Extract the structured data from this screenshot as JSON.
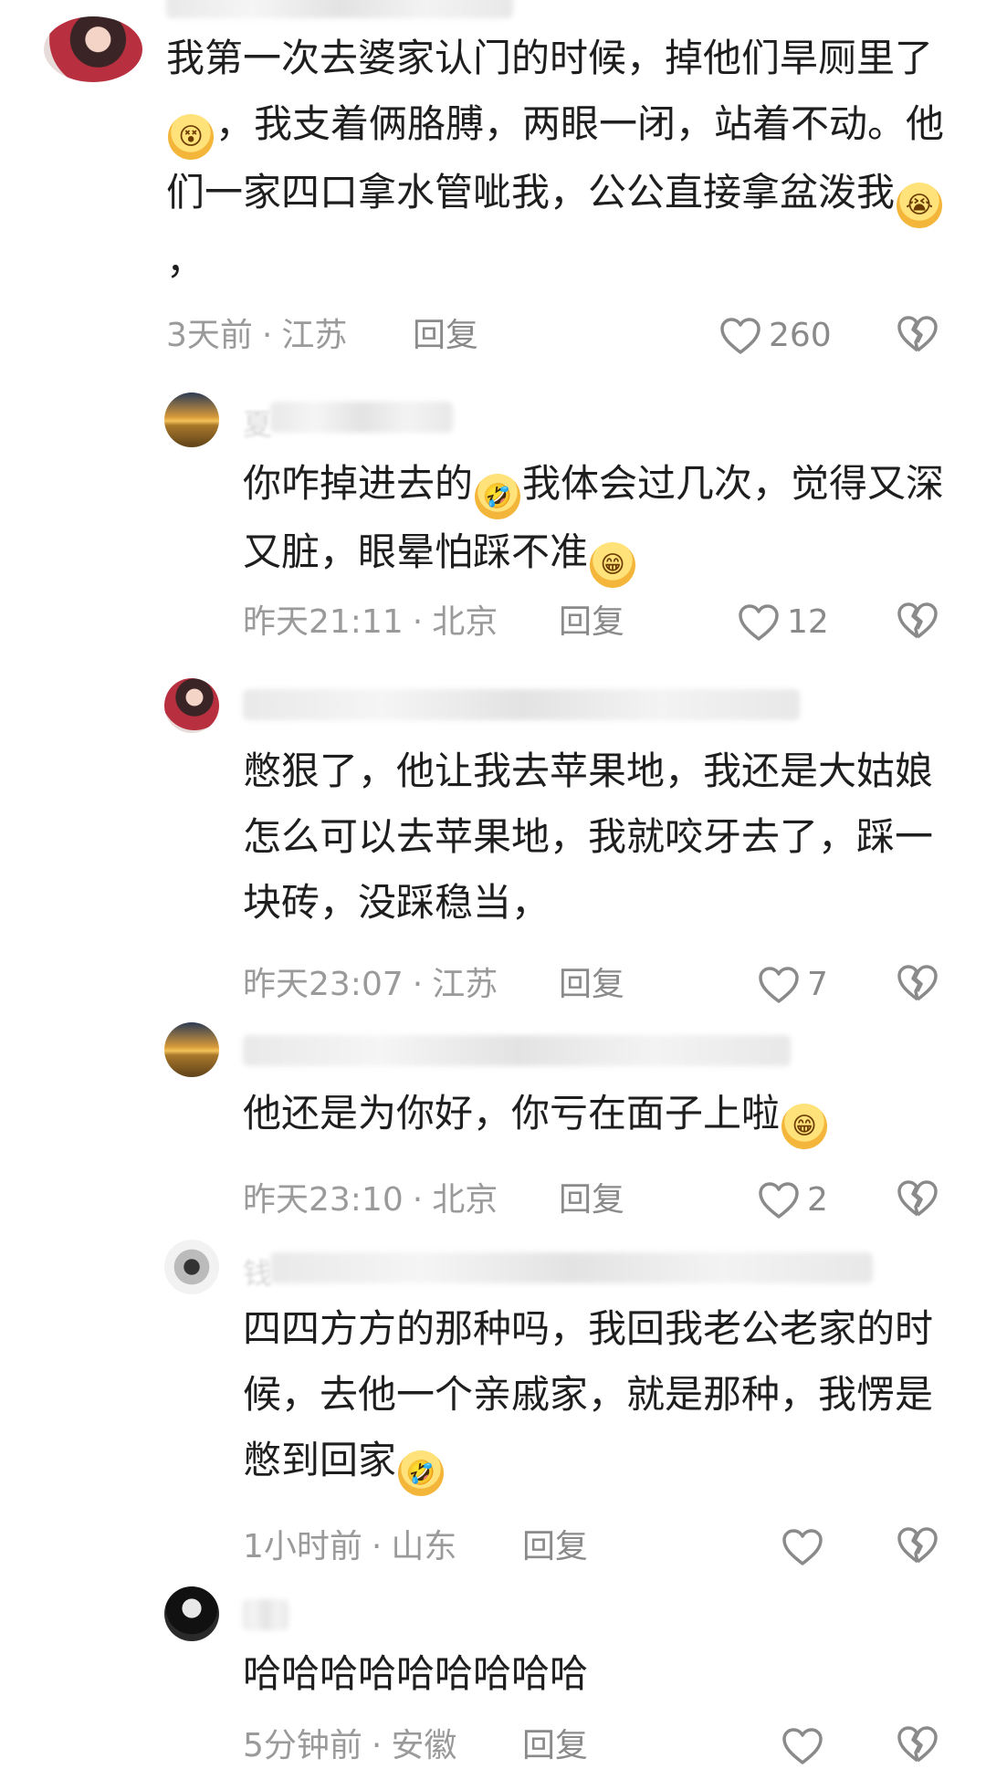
{
  "comments": [
    {
      "name_hint": "",
      "text_pre": "我第一次去婆家认门的时候，掉他们旱厕里了",
      "emoji1": "😵",
      "text_mid": "，我支着俩胳膊，两眼一闭，站着不动。他们一家四口拿水管呲我，公公直接拿盆泼我",
      "emoji2": "😭",
      "text_post": "，",
      "time": "3天前",
      "location": "江苏",
      "reply": "回复",
      "likes": "260"
    },
    {
      "name_hint": "夏",
      "text_pre": "你咋掉进去的",
      "emoji1": "🤣",
      "text_mid": "我体会过几次，觉得又深又脏，眼晕怕踩不准",
      "emoji2": "😁",
      "text_post": "",
      "time": "昨天21:11",
      "location": "北京",
      "reply": "回复",
      "likes": "12"
    },
    {
      "name_hint": "",
      "text_pre": "憋狠了，他让我去苹果地，我还是大姑娘怎么可以去苹果地，我就咬牙去了，踩一块砖，没踩稳当，",
      "emoji1": "",
      "text_mid": "",
      "emoji2": "",
      "text_post": "",
      "time": "昨天23:07",
      "location": "江苏",
      "reply": "回复",
      "likes": "7"
    },
    {
      "name_hint": "",
      "text_pre": "他还是为你好，你亏在面子上啦",
      "emoji1": "😁",
      "text_mid": "",
      "emoji2": "",
      "text_post": "",
      "time": "昨天23:10",
      "location": "北京",
      "reply": "回复",
      "likes": "2"
    },
    {
      "name_hint": "钱",
      "text_pre": "四四方方的那种吗，我回我老公老家的时候，去他一个亲戚家，就是那种，我愣是憋到回家",
      "emoji1": "🤣",
      "text_mid": "",
      "emoji2": "",
      "text_post": "",
      "time": "1小时前",
      "location": "山东",
      "reply": "回复",
      "likes": ""
    },
    {
      "name_hint": "",
      "text_pre": "哈哈哈哈哈哈哈哈哈",
      "emoji1": "",
      "text_mid": "",
      "emoji2": "",
      "text_post": "",
      "time": "5分钟前",
      "location": "安徽",
      "reply": "回复",
      "likes": ""
    }
  ],
  "icons": {
    "like": "heart-outline-icon",
    "dislike": "broken-heart-icon"
  },
  "colors": {
    "text": "#1e1e1e",
    "meta": "#9a9a9a",
    "icon": "#8a8a8a"
  }
}
